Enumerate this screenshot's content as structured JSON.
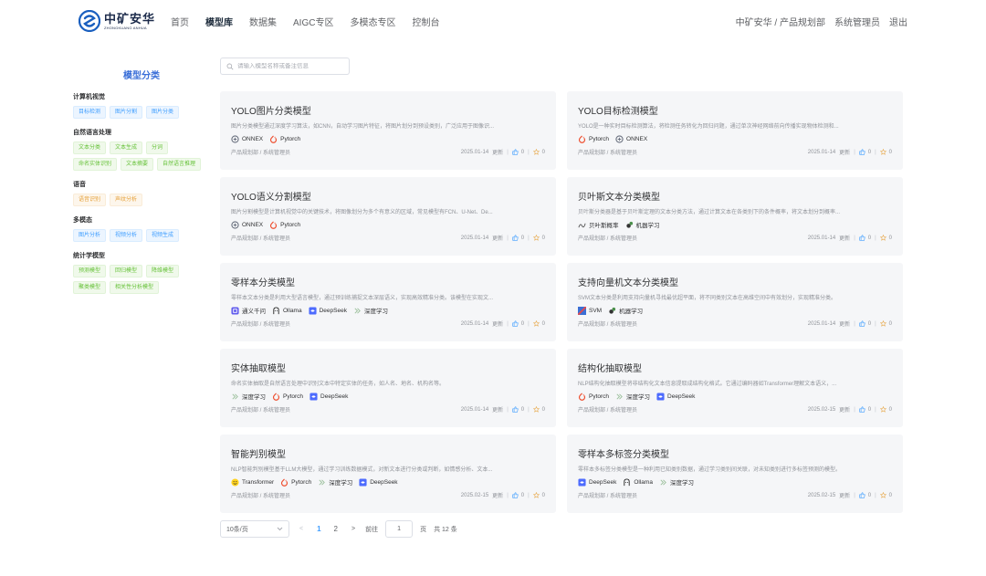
{
  "header": {
    "logo_cn": "中矿安华",
    "logo_en": "ZHONGKUANG ANHUA",
    "nav": [
      "首页",
      "模型库",
      "数据集",
      "AIGC专区",
      "多模态专区",
      "控制台"
    ],
    "active_nav": "模型库",
    "org": "中矿安华 / 产品规划部",
    "user": "系统管理员",
    "logout": "退出"
  },
  "sidebar": {
    "title": "模型分类",
    "categories": [
      {
        "name": "计算机视觉",
        "color": "blue",
        "tags": [
          "目标检测",
          "图片分割",
          "图片分类"
        ]
      },
      {
        "name": "自然语言处理",
        "color": "green",
        "tags": [
          "文本分类",
          "文本生成",
          "分词",
          "命名实体识别",
          "文本摘要",
          "自然语言推理"
        ]
      },
      {
        "name": "语音",
        "color": "orange",
        "tags": [
          "语音识别",
          "声纹分析"
        ]
      },
      {
        "name": "多模态",
        "color": "blue",
        "tags": [
          "图片分析",
          "视频分析",
          "视频生成"
        ]
      },
      {
        "name": "统计学模型",
        "color": "green",
        "tags": [
          "预测模型",
          "回归模型",
          "降维模型",
          "聚类模型",
          "相关性分析模型"
        ]
      }
    ]
  },
  "search": {
    "placeholder": "请输入模型名称或备注信息"
  },
  "cards": [
    {
      "title": "YOLO图片分类模型",
      "desc": "图片分类模型通过深度学习算法，如CNN，自动学习图片特征，将图片划分到预设类别，广泛应用于图像识...",
      "tags": [
        {
          "label": "ONNEX",
          "icon": "onnx-icon"
        },
        {
          "label": "Pytorch",
          "icon": "pytorch-icon"
        }
      ],
      "author": "产品规划部 / 系统管理员",
      "date": "2025.01-14",
      "update": "更新",
      "likes": "0",
      "stars": "0"
    },
    {
      "title": "YOLO目标检测模型",
      "desc": "YOLO是一种实时目标检测算法，将检测任务转化为回归问题，通过单次神经网络前向传播实现物体检测和...",
      "tags": [
        {
          "label": "Pytorch",
          "icon": "pytorch-icon"
        },
        {
          "label": "ONNEX",
          "icon": "onnx-icon"
        }
      ],
      "author": "产品规划部 / 系统管理员",
      "date": "2025.01-14",
      "update": "更新",
      "likes": "0",
      "stars": "0"
    },
    {
      "title": "YOLO语义分割模型",
      "desc": "图片分割模型是计算机视觉中的关键技术，将图像划分为多个有意义的区域，常见模型有FCN、U-Net、De...",
      "tags": [
        {
          "label": "ONNEX",
          "icon": "onnx-icon"
        },
        {
          "label": "Pytorch",
          "icon": "pytorch-icon"
        }
      ],
      "author": "产品规划部 / 系统管理员",
      "date": "2025.01-14",
      "update": "更新",
      "likes": "0",
      "stars": "0"
    },
    {
      "title": "贝叶斯文本分类模型",
      "desc": "贝叶斯分类器是基于贝叶斯定理的文本分类方法，通过计算文本在各类别下的条件概率，将文本划分到概率...",
      "tags": [
        {
          "label": "贝叶斯概率",
          "icon": "bayes-icon"
        },
        {
          "label": "机器学习",
          "icon": "ml-icon"
        }
      ],
      "author": "产品规划部 / 系统管理员",
      "date": "2025.01-14",
      "update": "更新",
      "likes": "0",
      "stars": "0"
    },
    {
      "title": "零样本分类模型",
      "desc": "零样本文本分类是利用大型语言模型，通过预训练捕捉文本深层语义，实现高效精准分类。该模型在实现文...",
      "tags": [
        {
          "label": "通义千问",
          "icon": "qwen-icon"
        },
        {
          "label": "Ollama",
          "icon": "ollama-icon"
        },
        {
          "label": "DeepSeek",
          "icon": "deepseek-icon"
        },
        {
          "label": "深度学习",
          "icon": "dl-icon"
        }
      ],
      "author": "产品规划部 / 系统管理员",
      "date": "2025.01-14",
      "update": "更新",
      "likes": "0",
      "stars": "0"
    },
    {
      "title": "支持向量机文本分类模型",
      "desc": "SVM文本分类是利用支持向量机寻找最优超平面，将不同类别文本在高维空间中有效划分，实现精准分类。",
      "tags": [
        {
          "label": "SVM",
          "icon": "svm-icon"
        },
        {
          "label": "机器学习",
          "icon": "ml-icon"
        }
      ],
      "author": "产品规划部 / 系统管理员",
      "date": "2025.01-14",
      "update": "更新",
      "likes": "0",
      "stars": "0"
    },
    {
      "title": "实体抽取模型",
      "desc": "命名实体抽取是自然语言处理中识别文本中特定实体的任务，如人名、地名、机构名等。",
      "tags": [
        {
          "label": "深度学习",
          "icon": "dl-icon"
        },
        {
          "label": "Pytorch",
          "icon": "pytorch-icon"
        },
        {
          "label": "DeepSeek",
          "icon": "deepseek-icon"
        }
      ],
      "author": "产品规划部 / 系统管理员",
      "date": "2025.01-14",
      "update": "更新",
      "likes": "0",
      "stars": "0"
    },
    {
      "title": "结构化抽取模型",
      "desc": "NLP结构化抽取模型将非结构化文本信息提取成结构化格式。它通过编码器如Transformer理解文本语义，...",
      "tags": [
        {
          "label": "Pytorch",
          "icon": "pytorch-icon"
        },
        {
          "label": "深度学习",
          "icon": "dl-icon"
        },
        {
          "label": "DeepSeek",
          "icon": "deepseek-icon"
        }
      ],
      "author": "产品规划部 / 系统管理员",
      "date": "2025.02-15",
      "update": "更新",
      "likes": "0",
      "stars": "0"
    },
    {
      "title": "智能判别模型",
      "desc": "NLP智能判别模型基于LLM大模型，通过学习训练数据模式，对新文本进行分类或判断，如情感分析、文本...",
      "tags": [
        {
          "label": "Transformer",
          "icon": "hf-icon"
        },
        {
          "label": "Pytorch",
          "icon": "pytorch-icon"
        },
        {
          "label": "深度学习",
          "icon": "dl-icon"
        },
        {
          "label": "DeepSeek",
          "icon": "deepseek-icon"
        }
      ],
      "author": "产品规划部 / 系统管理员",
      "date": "2025.02-15",
      "update": "更新",
      "likes": "0",
      "stars": "0"
    },
    {
      "title": "零样本多标签分类模型",
      "desc": "零样本多标签分类模型是一种利用已知类别数据，通过学习类别间关联，对未知类别进行多标签预测的模型。",
      "tags": [
        {
          "label": "DeepSeek",
          "icon": "deepseek-icon"
        },
        {
          "label": "Ollama",
          "icon": "ollama-icon"
        },
        {
          "label": "深度学习",
          "icon": "dl-icon"
        }
      ],
      "author": "产品规划部 / 系统管理员",
      "date": "2025.02-15",
      "update": "更新",
      "likes": "0",
      "stars": "0"
    }
  ],
  "pagination": {
    "page_size": "10条/页",
    "pages": [
      "1",
      "2"
    ],
    "current": "1",
    "goto_label": "前往",
    "goto_value": "1",
    "page_unit": "页",
    "total": "共 12 条"
  },
  "colors": {
    "accent": "#409eff",
    "card_bg": "#f5f6f8",
    "sidebar_title": "#3a6fd8"
  }
}
